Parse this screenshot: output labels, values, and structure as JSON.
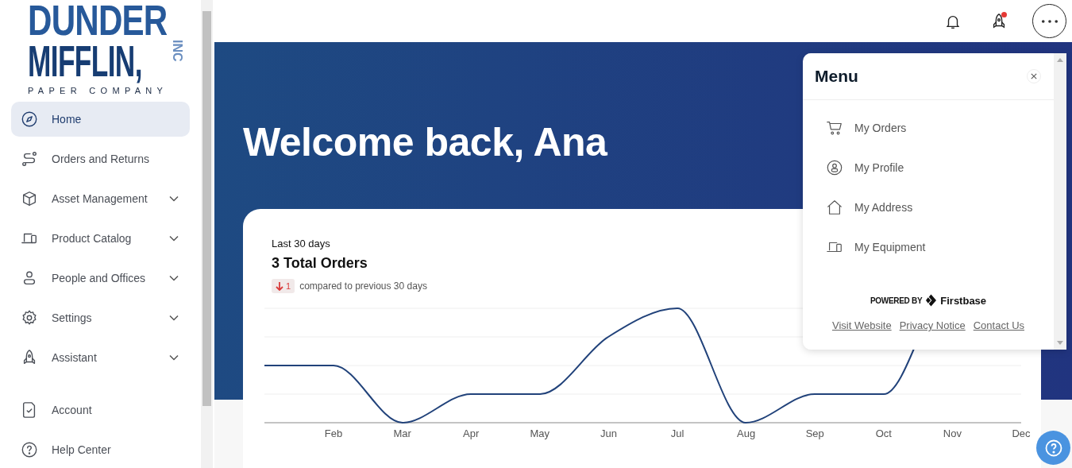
{
  "logo": {
    "line_1": "DUNDER",
    "line_2": "MIFFLIN,",
    "suffix": "INC",
    "tagline": "PAPER COMPANY"
  },
  "sidebar": {
    "items": [
      {
        "label": "Home",
        "selected": true,
        "expandable": false
      },
      {
        "label": "Orders and Returns",
        "selected": false,
        "expandable": false
      },
      {
        "label": "Asset Management",
        "selected": false,
        "expandable": true
      },
      {
        "label": "Product Catalog",
        "selected": false,
        "expandable": true
      },
      {
        "label": "People and Offices",
        "selected": false,
        "expandable": true
      },
      {
        "label": "Settings",
        "selected": false,
        "expandable": true
      },
      {
        "label": "Assistant",
        "selected": false,
        "expandable": true
      }
    ],
    "footer_items": [
      {
        "label": "Account",
        "selected": false
      },
      {
        "label": "Help Center",
        "selected": false
      }
    ]
  },
  "header": {
    "assistant_alert": true
  },
  "banner": {
    "title": "Welcome back, Ana"
  },
  "orders_card": {
    "period": "Last 30 days",
    "total": "3 Total Orders",
    "change": {
      "value": "1"
    },
    "comparison": "compared to previous 30 days",
    "chart": {
      "kind": "picture",
      "x_labels": [
        "Feb",
        "Mar",
        "Apr",
        "May",
        "Jun",
        "Jul",
        "Aug",
        "Sep",
        "Oct",
        "Nov",
        "Dec"
      ]
    }
  },
  "menu": {
    "title": "Menu",
    "items": [
      {
        "label": "My Orders"
      },
      {
        "label": "My Profile"
      },
      {
        "label": "My Address"
      },
      {
        "label": "My Equipment"
      }
    ],
    "powered_by": "POWERED BY",
    "brand": "Firstbase",
    "links": [
      "Visit Website",
      "Privacy Notice",
      "Contact Us"
    ]
  }
}
